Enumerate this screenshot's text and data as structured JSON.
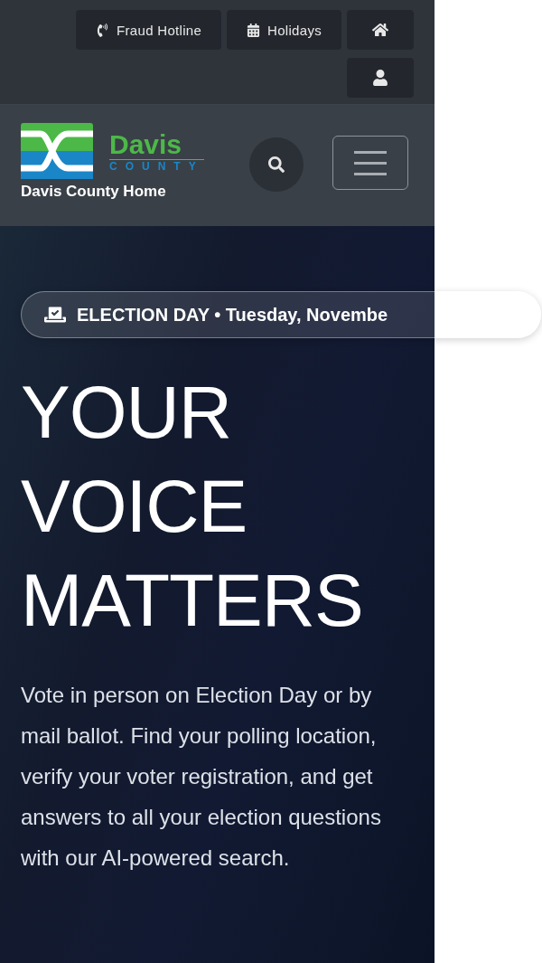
{
  "utility_bar": {
    "buttons": [
      {
        "kind": "phone",
        "label": "Fraud Hotline"
      },
      {
        "kind": "calendar",
        "label": "Holidays"
      },
      {
        "kind": "home"
      },
      {
        "kind": "user"
      }
    ]
  },
  "header": {
    "logo": {
      "name": "Davis",
      "subtitle": "COUNTY"
    },
    "home_link": "Davis County Home"
  },
  "hero": {
    "badge": "ELECTION DAY • Tuesday, Novembe",
    "title_lines": [
      "YOUR",
      "VOICE",
      "MATTERS"
    ],
    "description": "Vote in person on Election Day or by mail ballot. Find your polling location, verify your voter registration, and get answers to all your election questions with our AI-powered search."
  }
}
